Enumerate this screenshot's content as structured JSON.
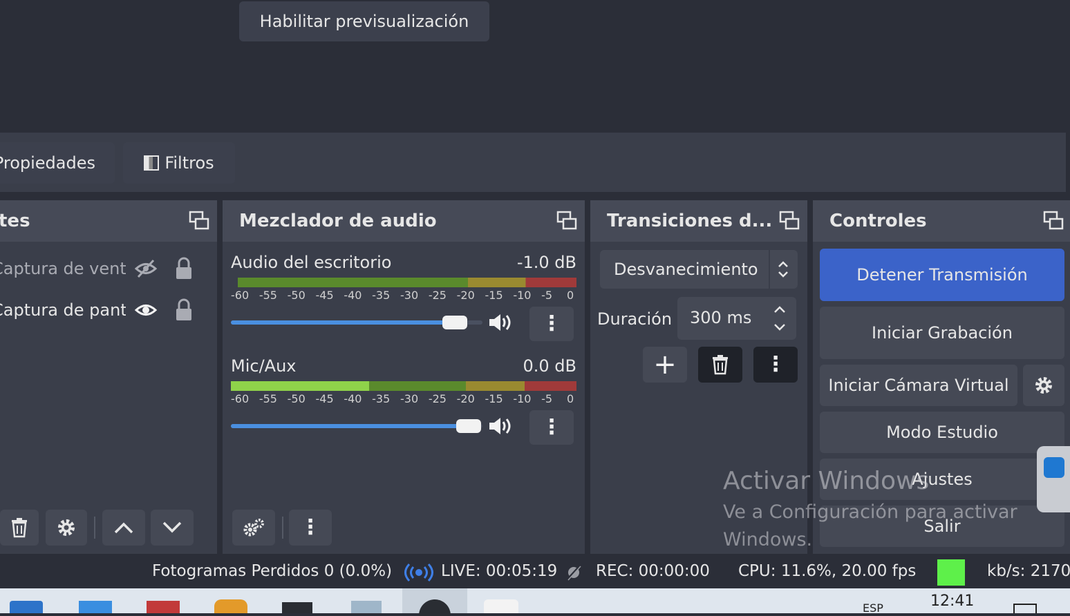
{
  "preview": {
    "enable_label": "Habilitar previsualización"
  },
  "prop_bar": {
    "properties_label": "Propiedades",
    "filters_label": "Filtros"
  },
  "sources": {
    "title": "tes",
    "items": [
      {
        "label": "Captura de venta",
        "visible": false
      },
      {
        "label": "Captura de pant",
        "visible": true
      }
    ]
  },
  "mixer": {
    "title": "Mezclador de audio",
    "channels": [
      {
        "name": "Audio del escritorio",
        "db": "-1.0 dB",
        "volume": 0.93
      },
      {
        "name": "Mic/Aux",
        "db": "0.0 dB",
        "volume": 1.0
      }
    ],
    "ticks": [
      "-60",
      "-55",
      "-50",
      "-45",
      "-40",
      "-35",
      "-30",
      "-25",
      "-20",
      "-15",
      "-10",
      "-5",
      "0"
    ]
  },
  "transitions": {
    "title": "Transiciones d...",
    "selected": "Desvanecimiento",
    "duration_label": "Duración",
    "duration_value": "300 ms"
  },
  "controls": {
    "title": "Controles",
    "stop_stream": "Detener Transmisión",
    "start_record": "Iniciar Grabación",
    "virtual_cam": "Iniciar Cámara Virtual",
    "studio_mode": "Modo Estudio",
    "settings": "Ajustes",
    "exit": "Salir"
  },
  "status": {
    "dropped": "Fotogramas Perdidos 0 (0.0%)",
    "live": "LIVE: 00:05:19",
    "rec": "REC: 00:00:00",
    "cpu": "CPU: 11.6%, 20.00 fps",
    "kbs": "kb/s: 2170",
    "health_color": "#5ef04a"
  },
  "watermark": {
    "line1": "Activar Windows",
    "line2": "Ve a Configuración para activar",
    "line3": "Windows."
  },
  "taskbar": {
    "clock": "12:41",
    "lang": "ESP"
  },
  "colors": {
    "accent": "#3b63c9",
    "slider": "#4a8fe0"
  }
}
